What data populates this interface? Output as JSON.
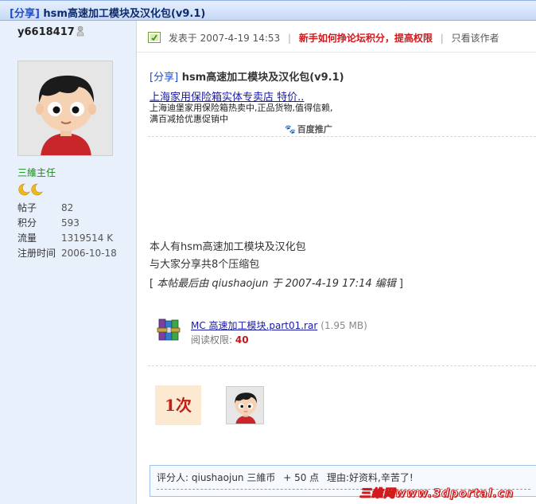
{
  "thread": {
    "tag": "[分享]",
    "title": "hsm高速加工模块及汉化包(v9.1)"
  },
  "author": {
    "username": "y6618417",
    "online_icon": "offline-user-icon",
    "rank": "三維主任",
    "stats": [
      {
        "label": "帖子",
        "value": "82"
      },
      {
        "label": "积分",
        "value": "593"
      },
      {
        "label": "流量",
        "value": "1319514 K"
      },
      {
        "label": "注册时间",
        "value": "2006-10-18"
      }
    ]
  },
  "post": {
    "posted_label": "发表于",
    "posted_time": "2007-4-19 14:53",
    "separator": "|",
    "hot_link": "新手如何挣论坛积分，提高权限",
    "only_author": "只看该作者",
    "title_tag": "[分享]",
    "title": "hsm高速加工模块及汉化包(v9.1)",
    "ad": {
      "link": "上海家用保险箱实体专卖店 特价..",
      "desc": "上海迪堡家用保险箱热卖中,正品货物,值得信赖,满百减拾优惠促销中",
      "brand": "百度推广",
      "brand_icon": "paw-icon"
    },
    "body_lines": [
      "本人有hsm高速加工模块及汉化包",
      "与大家分享共8个压缩包"
    ],
    "edit_note": {
      "open": "[ ",
      "text": "本帖最后由 qiushaojun 于 2007-4-19 17:14 编辑",
      "close": " ]"
    },
    "attachment": {
      "icon": "rar-archive-icon",
      "name": "MC 高速加工模块.part01.rar",
      "size": "(1.95 MB)",
      "perm_label": "阅读权限:",
      "perm_value": "40"
    },
    "view_count": "1次",
    "rating": {
      "label": "评分人:",
      "rater": "qiushaojun",
      "currency": "三維币",
      "points": "+ 50 点",
      "reason_label": "理由:",
      "reason": "好资料,辛苦了!"
    }
  },
  "watermark": "三维网www.3dportal.cn",
  "colors": {
    "title_bar": "#c7d9f7",
    "sidebar_bg": "#e8f0fc",
    "rank_green": "#1a8a1a",
    "hot_red": "#d0171b",
    "link_blue": "#1a1aa6"
  }
}
